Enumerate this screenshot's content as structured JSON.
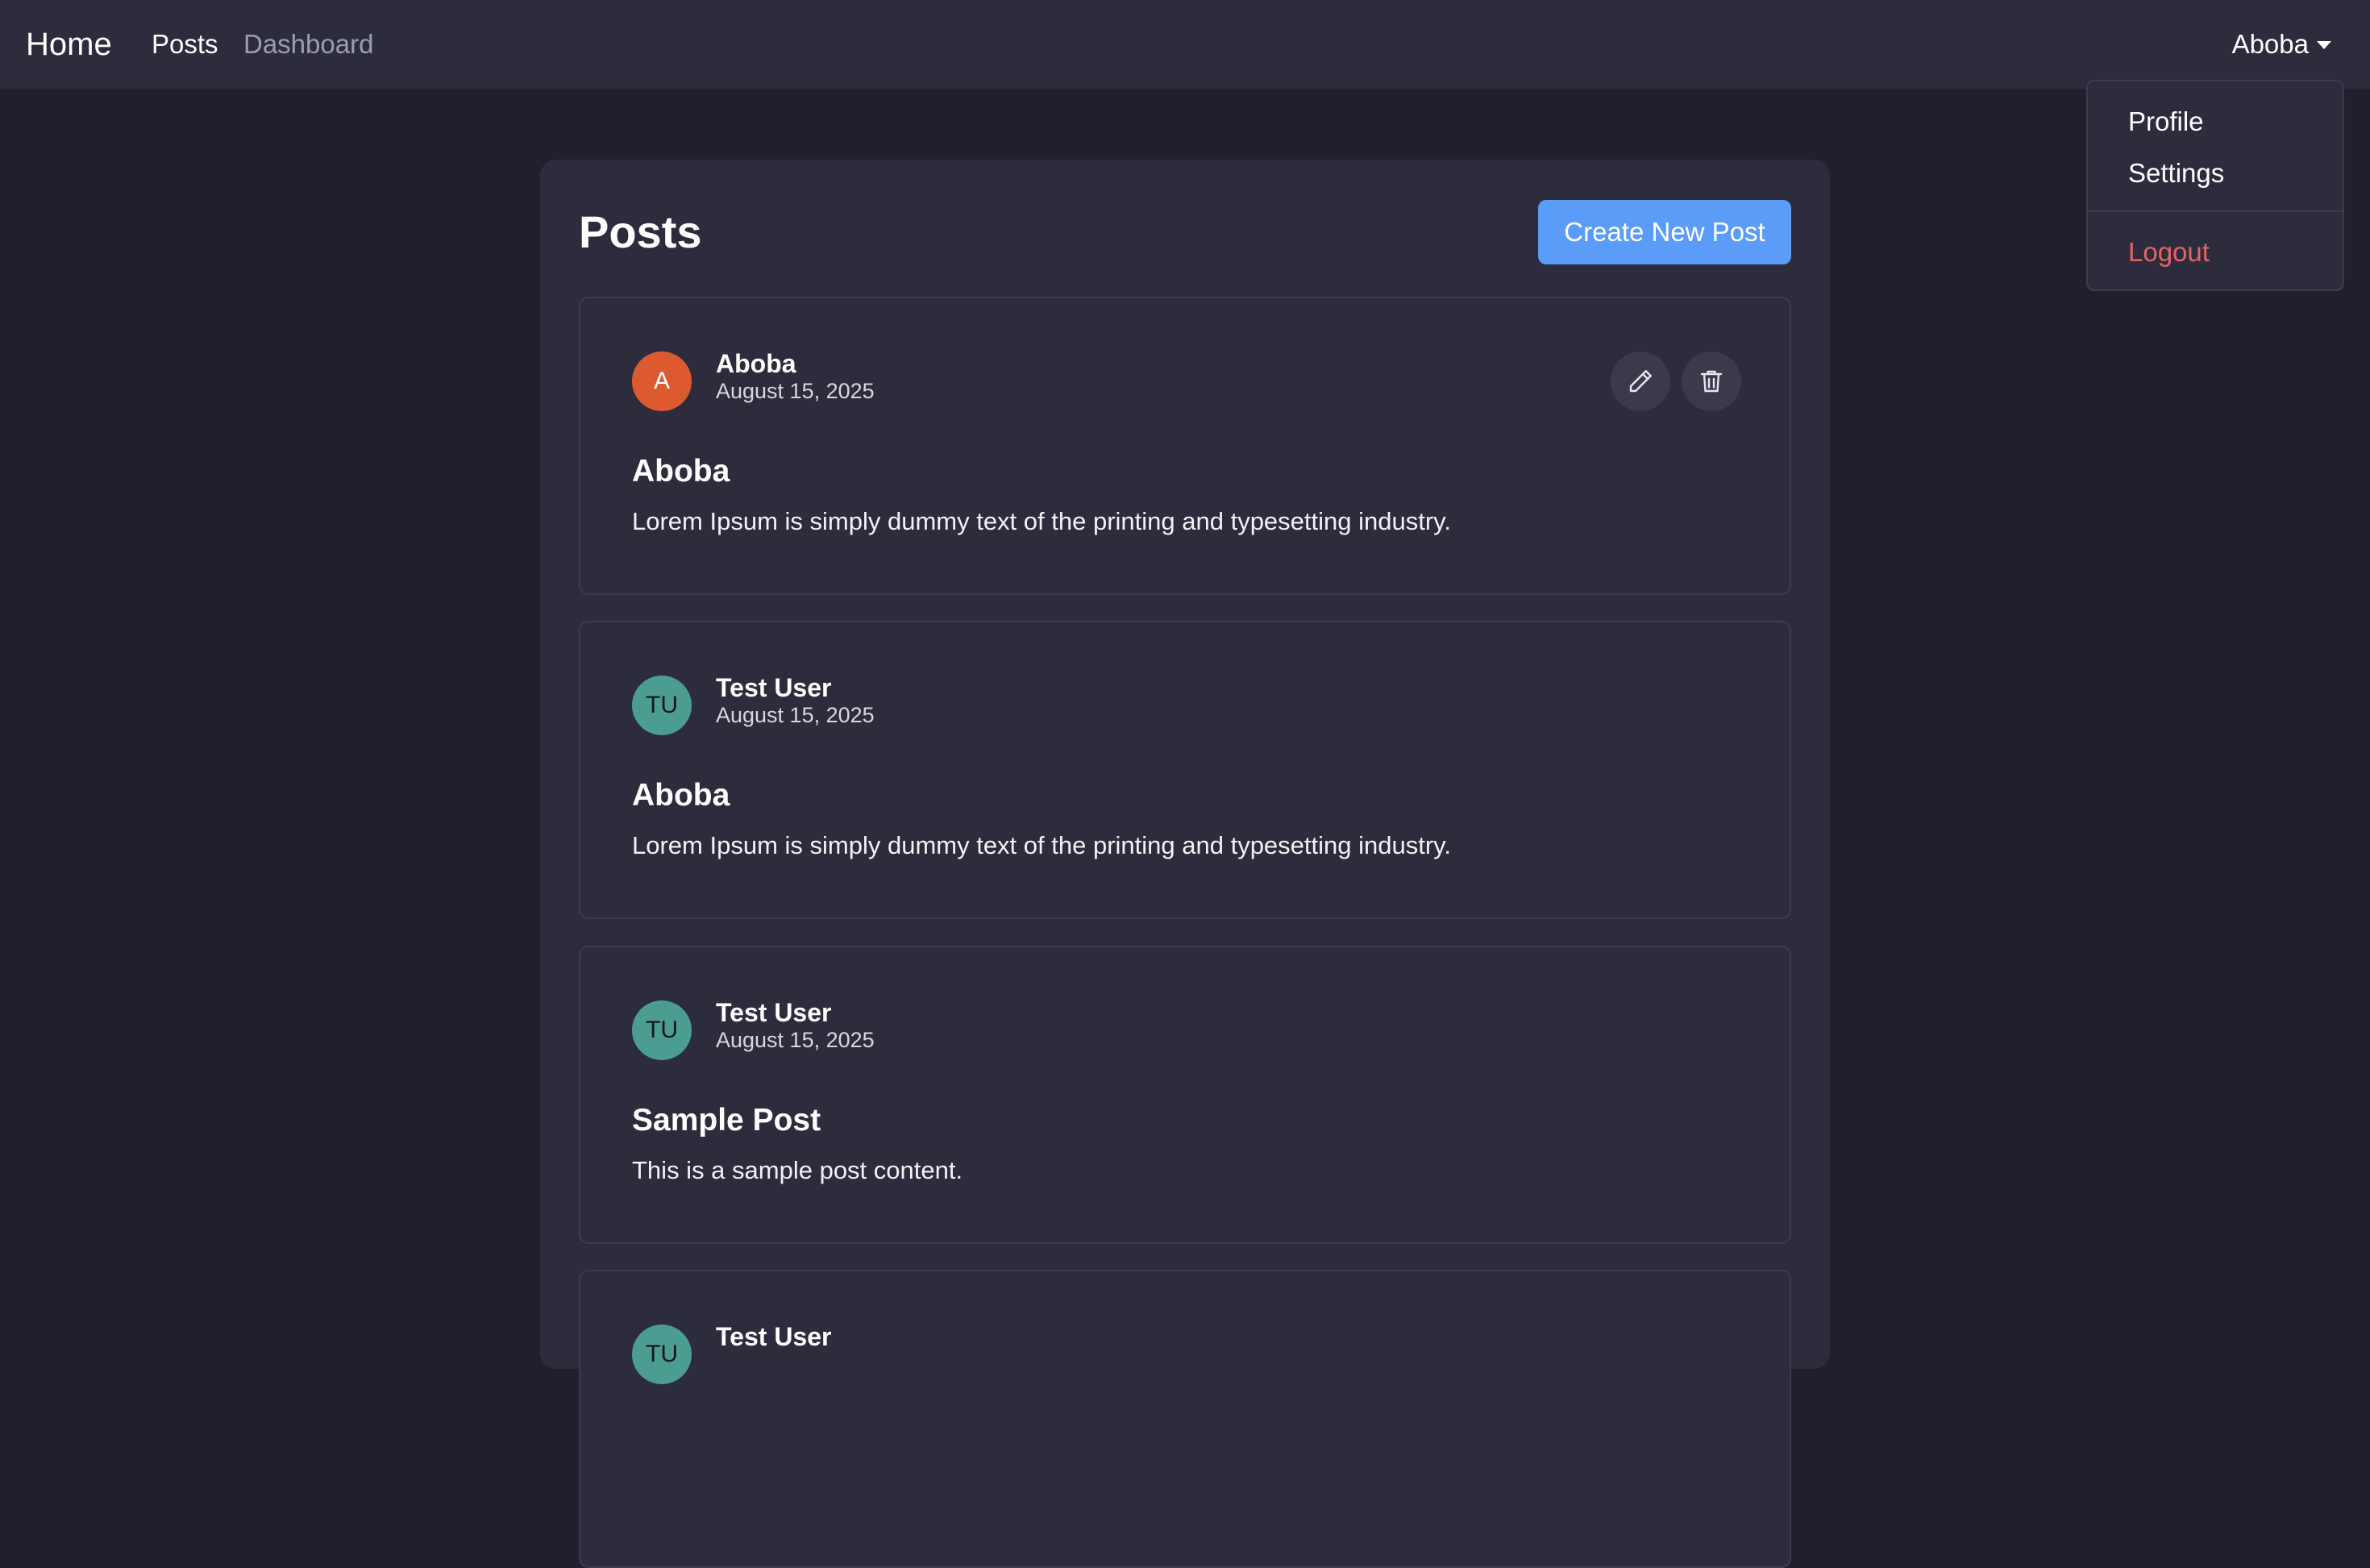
{
  "navbar": {
    "brand": "Home",
    "links": [
      "Posts",
      "Dashboard"
    ],
    "user": "Aboba"
  },
  "dropdown": {
    "items": [
      "Profile",
      "Settings"
    ],
    "logout": "Logout"
  },
  "page": {
    "title": "Posts",
    "create_button": "Create New Post"
  },
  "posts": [
    {
      "avatar": "A",
      "avatar_color": "#dd5a30",
      "author": "Aboba",
      "date": "August 15, 2025",
      "title": "Aboba",
      "body": "Lorem Ipsum is simply dummy text of the printing and typesetting industry.",
      "actions": [
        "pencil-icon",
        "trash-icon"
      ]
    },
    {
      "avatar": "TU",
      "avatar_color": "#4c9d91",
      "author": "Test User",
      "date": "August 15, 2025",
      "title": "Aboba",
      "body": "Lorem Ipsum is simply dummy text of the printing and typesetting industry."
    },
    {
      "avatar": "TU",
      "avatar_color": "#4c9d91",
      "author": "Test User",
      "date": "August 15, 2025",
      "title": "Sample Post",
      "body": "This is a sample post content."
    },
    {
      "avatar": "TU",
      "avatar_color": "#4c9d91",
      "author": "Test User"
    }
  ]
}
